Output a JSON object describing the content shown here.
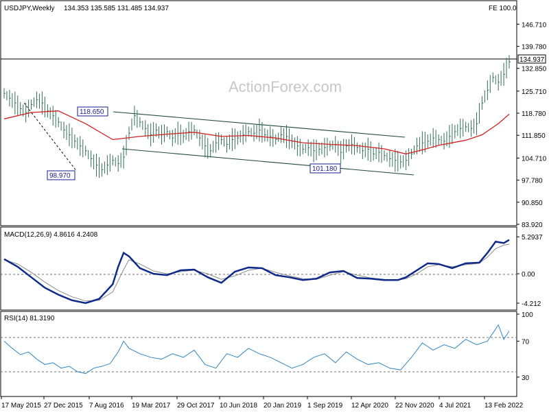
{
  "header": {
    "symbol": "USDJPY,Weekly",
    "ohlc": "134.353 135.585 131.485 134.937",
    "fe": "FE 100.0"
  },
  "watermark": "ActionForex.com",
  "chart_data": [
    {
      "type": "candlestick",
      "panel": "price",
      "title": "USDJPY,Weekly",
      "ylim": [
        83.92,
        150.0
      ],
      "y_ticks": [
        "146.710",
        "139.780",
        "132.850",
        "125.710",
        "118.780",
        "111.850",
        "104.710",
        "97.780",
        "90.850",
        "83.920"
      ],
      "last_value_label": "134.937",
      "x_ticks": [
        "17 May 2015",
        "27 Dec 2015",
        "7 Aug 2016",
        "19 Mar 2017",
        "29 Oct 2017",
        "10 Jun 2018",
        "20 Jan 2019",
        "1 Sep 2019",
        "12 Apr 2020",
        "22 Nov 2020",
        "4 Jul 2021",
        "13 Feb 2022"
      ],
      "series": [
        {
          "name": "USDJPY weekly",
          "points": [
            [
              0,
              125.0
            ],
            [
              2,
              123.5
            ],
            [
              4,
              122.0
            ],
            [
              6,
              120.2
            ],
            [
              8,
              119.0
            ],
            [
              10,
              121.5
            ],
            [
              12,
              123.0
            ],
            [
              14,
              122.0
            ],
            [
              16,
              119.5
            ],
            [
              18,
              118.0
            ],
            [
              20,
              116.0
            ],
            [
              22,
              113.5
            ],
            [
              24,
              112.0
            ],
            [
              26,
              110.0
            ],
            [
              28,
              108.5
            ],
            [
              30,
              107.0
            ],
            [
              32,
              104.5
            ],
            [
              34,
              102.5
            ],
            [
              36,
              101.0
            ],
            [
              38,
              102.5
            ],
            [
              40,
              104.0
            ],
            [
              42,
              103.0
            ],
            [
              44,
              105.0
            ],
            [
              46,
              112.5
            ],
            [
              48,
              118.0
            ],
            [
              50,
              116.0
            ],
            [
              52,
              114.0
            ],
            [
              54,
              112.0
            ],
            [
              56,
              113.5
            ],
            [
              58,
              112.0
            ],
            [
              60,
              113.0
            ],
            [
              62,
              111.0
            ],
            [
              64,
              112.5
            ],
            [
              66,
              111.5
            ],
            [
              68,
              113.0
            ],
            [
              70,
              113.5
            ],
            [
              72,
              111.0
            ],
            [
              74,
              108.5
            ],
            [
              76,
              107.0
            ],
            [
              78,
              109.5
            ],
            [
              80,
              110.5
            ],
            [
              82,
              109.0
            ],
            [
              84,
              110.5
            ],
            [
              86,
              111.0
            ],
            [
              88,
              112.0
            ],
            [
              90,
              113.0
            ],
            [
              92,
              112.5
            ],
            [
              94,
              113.5
            ],
            [
              96,
              112.0
            ],
            [
              98,
              111.5
            ],
            [
              100,
              110.5
            ],
            [
              102,
              112.0
            ],
            [
              104,
              111.5
            ],
            [
              106,
              110.0
            ],
            [
              108,
              108.5
            ],
            [
              110,
              107.5
            ],
            [
              112,
              108.0
            ],
            [
              114,
              107.0
            ],
            [
              116,
              107.5
            ],
            [
              118,
              108.0
            ],
            [
              120,
              108.5
            ],
            [
              122,
              109.0
            ],
            [
              124,
              106.5
            ],
            [
              126,
              108.5
            ],
            [
              128,
              109.0
            ],
            [
              130,
              108.0
            ],
            [
              132,
              107.0
            ],
            [
              134,
              107.5
            ],
            [
              136,
              106.0
            ],
            [
              138,
              106.5
            ],
            [
              140,
              105.5
            ],
            [
              142,
              104.5
            ],
            [
              144,
              104.0
            ],
            [
              146,
              103.5
            ],
            [
              148,
              104.0
            ],
            [
              150,
              106.0
            ],
            [
              152,
              108.5
            ],
            [
              154,
              109.5
            ],
            [
              156,
              110.0
            ],
            [
              158,
              111.0
            ],
            [
              160,
              110.5
            ],
            [
              162,
              110.0
            ],
            [
              164,
              111.5
            ],
            [
              166,
              113.0
            ],
            [
              168,
              114.0
            ],
            [
              170,
              114.5
            ],
            [
              172,
              114.0
            ],
            [
              174,
              115.5
            ],
            [
              176,
              122.0
            ],
            [
              178,
              126.0
            ],
            [
              180,
              130.0
            ],
            [
              182,
              128.5
            ],
            [
              184,
              131.0
            ],
            [
              186,
              134.9
            ]
          ]
        },
        {
          "name": "Moving average",
          "points": [
            [
              0,
              117.0
            ],
            [
              10,
              119.0
            ],
            [
              20,
              119.5
            ],
            [
              30,
              115.5
            ],
            [
              40,
              110.5
            ],
            [
              50,
              111.5
            ],
            [
              60,
              112.2
            ],
            [
              70,
              112.8
            ],
            [
              80,
              111.5
            ],
            [
              90,
              111.8
            ],
            [
              100,
              111.0
            ],
            [
              110,
              109.5
            ],
            [
              120,
              109.0
            ],
            [
              130,
              108.6
            ],
            [
              140,
              107.6
            ],
            [
              148,
              106.0
            ],
            [
              155,
              107.5
            ],
            [
              160,
              108.7
            ],
            [
              170,
              110.3
            ],
            [
              176,
              112.0
            ],
            [
              182,
              115.5
            ],
            [
              186,
              118.5
            ]
          ]
        }
      ],
      "annotations": [
        "118.650",
        "98.970",
        "101.180"
      ]
    },
    {
      "type": "line",
      "panel": "macd",
      "title": "MACD(12,26,9) 4.8616 4.2408",
      "ylim": [
        -5.0,
        6.2
      ],
      "y_ticks": [
        "5.2937",
        "0.00",
        "-4.212"
      ],
      "series": [
        {
          "name": "MACD",
          "points": [
            [
              0,
              2.1
            ],
            [
              5,
              1.0
            ],
            [
              10,
              -0.5
            ],
            [
              15,
              -2.0
            ],
            [
              20,
              -3.0
            ],
            [
              25,
              -3.8
            ],
            [
              30,
              -4.2
            ],
            [
              35,
              -3.6
            ],
            [
              40,
              -1.5
            ],
            [
              42,
              1.0
            ],
            [
              44,
              3.0
            ],
            [
              46,
              2.5
            ],
            [
              50,
              0.8
            ],
            [
              55,
              0.0
            ],
            [
              60,
              -0.2
            ],
            [
              65,
              0.5
            ],
            [
              70,
              0.6
            ],
            [
              75,
              -0.5
            ],
            [
              80,
              -1.3
            ],
            [
              85,
              0.3
            ],
            [
              90,
              0.9
            ],
            [
              95,
              0.8
            ],
            [
              100,
              -0.2
            ],
            [
              105,
              -0.5
            ],
            [
              110,
              -0.9
            ],
            [
              115,
              -0.7
            ],
            [
              120,
              0.2
            ],
            [
              125,
              0.4
            ],
            [
              130,
              -0.6
            ],
            [
              135,
              -0.7
            ],
            [
              140,
              -0.9
            ],
            [
              145,
              -0.9
            ],
            [
              148,
              -0.5
            ],
            [
              152,
              0.5
            ],
            [
              156,
              1.5
            ],
            [
              160,
              1.4
            ],
            [
              165,
              0.8
            ],
            [
              170,
              1.5
            ],
            [
              175,
              1.6
            ],
            [
              178,
              3.0
            ],
            [
              181,
              4.6
            ],
            [
              184,
              4.4
            ],
            [
              186,
              4.86
            ]
          ]
        },
        {
          "name": "Signal",
          "points": [
            [
              0,
              2.0
            ],
            [
              5,
              1.4
            ],
            [
              10,
              0.2
            ],
            [
              15,
              -1.2
            ],
            [
              20,
              -2.4
            ],
            [
              25,
              -3.3
            ],
            [
              30,
              -3.9
            ],
            [
              35,
              -3.8
            ],
            [
              40,
              -2.6
            ],
            [
              44,
              0.6
            ],
            [
              46,
              2.0
            ],
            [
              50,
              1.4
            ],
            [
              55,
              0.4
            ],
            [
              60,
              0.0
            ],
            [
              65,
              0.3
            ],
            [
              70,
              0.5
            ],
            [
              75,
              0.0
            ],
            [
              80,
              -0.8
            ],
            [
              85,
              -0.3
            ],
            [
              90,
              0.5
            ],
            [
              95,
              0.8
            ],
            [
              100,
              0.2
            ],
            [
              105,
              -0.3
            ],
            [
              110,
              -0.7
            ],
            [
              115,
              -0.8
            ],
            [
              120,
              -0.2
            ],
            [
              125,
              0.3
            ],
            [
              130,
              -0.2
            ],
            [
              135,
              -0.6
            ],
            [
              140,
              -0.8
            ],
            [
              145,
              -0.9
            ],
            [
              148,
              -0.7
            ],
            [
              152,
              0.0
            ],
            [
              156,
              1.0
            ],
            [
              160,
              1.3
            ],
            [
              165,
              1.0
            ],
            [
              170,
              1.3
            ],
            [
              175,
              1.5
            ],
            [
              178,
              2.4
            ],
            [
              181,
              3.6
            ],
            [
              184,
              4.1
            ],
            [
              186,
              4.24
            ]
          ]
        }
      ]
    },
    {
      "type": "line",
      "panel": "rsi",
      "title": "RSI(14) 81.3190",
      "ylim": [
        10,
        100
      ],
      "y_ticks": [
        "100",
        "70",
        "30"
      ],
      "series": [
        {
          "name": "RSI",
          "points": [
            [
              0,
              70
            ],
            [
              3,
              62
            ],
            [
              6,
              55
            ],
            [
              9,
              58
            ],
            [
              12,
              50
            ],
            [
              15,
              44
            ],
            [
              18,
              46
            ],
            [
              21,
              40
            ],
            [
              24,
              42
            ],
            [
              27,
              36
            ],
            [
              30,
              34
            ],
            [
              33,
              40
            ],
            [
              36,
              42
            ],
            [
              39,
              45
            ],
            [
              42,
              58
            ],
            [
              44,
              70
            ],
            [
              46,
              62
            ],
            [
              50,
              56
            ],
            [
              54,
              52
            ],
            [
              58,
              50
            ],
            [
              62,
              56
            ],
            [
              66,
              52
            ],
            [
              70,
              60
            ],
            [
              74,
              44
            ],
            [
              78,
              40
            ],
            [
              82,
              56
            ],
            [
              86,
              52
            ],
            [
              90,
              62
            ],
            [
              94,
              56
            ],
            [
              98,
              52
            ],
            [
              102,
              46
            ],
            [
              106,
              40
            ],
            [
              110,
              44
            ],
            [
              114,
              52
            ],
            [
              118,
              56
            ],
            [
              122,
              46
            ],
            [
              126,
              58
            ],
            [
              130,
              50
            ],
            [
              134,
              44
            ],
            [
              138,
              46
            ],
            [
              142,
              40
            ],
            [
              146,
              38
            ],
            [
              150,
              52
            ],
            [
              154,
              68
            ],
            [
              158,
              60
            ],
            [
              162,
              66
            ],
            [
              166,
              62
            ],
            [
              170,
              72
            ],
            [
              174,
              66
            ],
            [
              178,
              70
            ],
            [
              182,
              88
            ],
            [
              184,
              72
            ],
            [
              186,
              81.3
            ]
          ]
        }
      ]
    }
  ],
  "colors": {
    "bars": "#2f6f55",
    "moving_average": "#d21f1f",
    "macd": "#0d2a8a",
    "signal": "#8a8a8a",
    "rsi": "#2f86c6"
  }
}
